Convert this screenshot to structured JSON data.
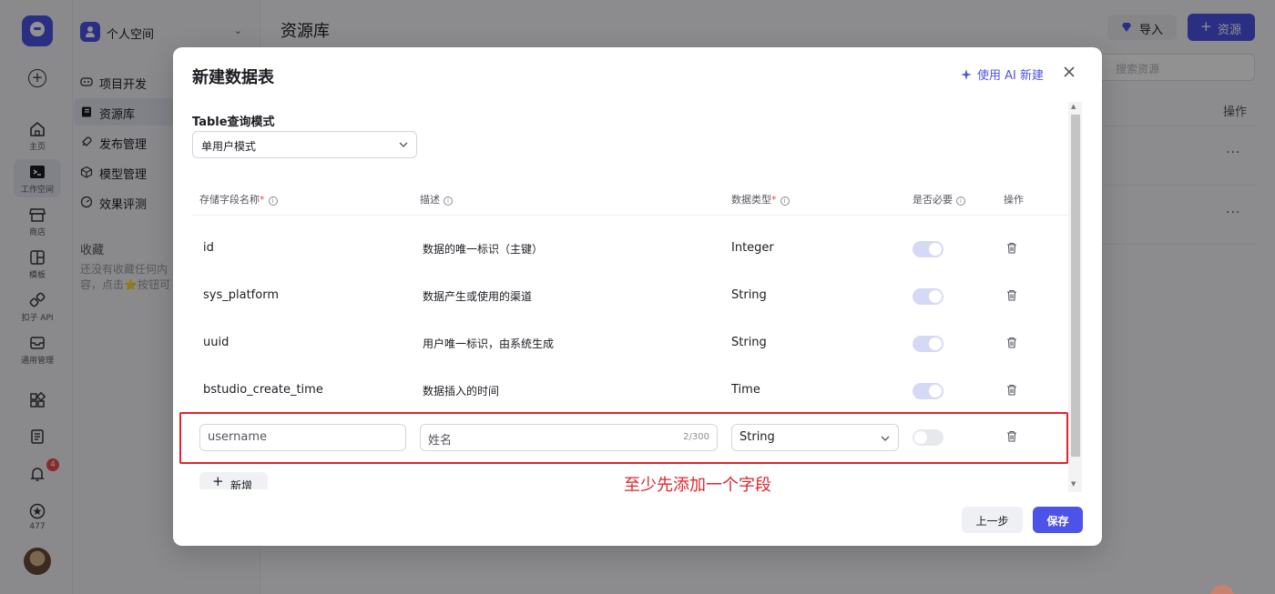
{
  "rail": {
    "items": [
      {
        "label": "主页",
        "icon": "home-icon"
      },
      {
        "label": "工作空间",
        "icon": "terminal-icon"
      },
      {
        "label": "商店",
        "icon": "store-icon"
      },
      {
        "label": "模板",
        "icon": "template-icon"
      },
      {
        "label": "扣子 API",
        "icon": "api-icon"
      },
      {
        "label": "通用管理",
        "icon": "inbox-icon"
      }
    ],
    "notification_count": "4",
    "star_count": "477"
  },
  "sidebar": {
    "space_name": "个人空间",
    "nav": [
      {
        "label": "项目开发"
      },
      {
        "label": "资源库"
      },
      {
        "label": "发布管理"
      },
      {
        "label": "模型管理"
      },
      {
        "label": "效果评测"
      }
    ],
    "favorites_title": "收藏",
    "favorites_empty": "还没有收藏任何内容，点击⭐按钮可将内容收藏"
  },
  "main": {
    "title": "资源库",
    "import_label": "导入",
    "add_resource_label": "资源",
    "search_placeholder": "搜索资源",
    "ops_header": "操作",
    "row_menu": "···"
  },
  "modal": {
    "title": "新建数据表",
    "ai_create_label": "使用 AI 新建",
    "mode_label": "Table查询模式",
    "mode_value": "单用户模式",
    "headers": {
      "name": "存储字段名称",
      "desc": "描述",
      "type": "数据类型",
      "required": "是否必要",
      "ops": "操作",
      "required_mark": "*",
      "info_glyph": "i"
    },
    "rows": [
      {
        "name": "id",
        "desc": "数据的唯一标识（主键）",
        "type": "Integer",
        "required": true
      },
      {
        "name": "sys_platform",
        "desc": "数据产生或使用的渠道",
        "type": "String",
        "required": true
      },
      {
        "name": "uuid",
        "desc": "用户唯一标识，由系统生成",
        "type": "String",
        "required": true
      },
      {
        "name": "bstudio_create_time",
        "desc": "数据插入的时间",
        "type": "Time",
        "required": true
      }
    ],
    "new_row": {
      "name": "username",
      "desc": "姓名",
      "desc_count": "2/300",
      "type": "String",
      "required": false
    },
    "add_label": "新增",
    "hint": "至少先添加一个字段",
    "prev_label": "上一步",
    "save_label": "保存"
  },
  "colors": {
    "accent": "#4d53e8",
    "highlight": "#e0252b"
  }
}
